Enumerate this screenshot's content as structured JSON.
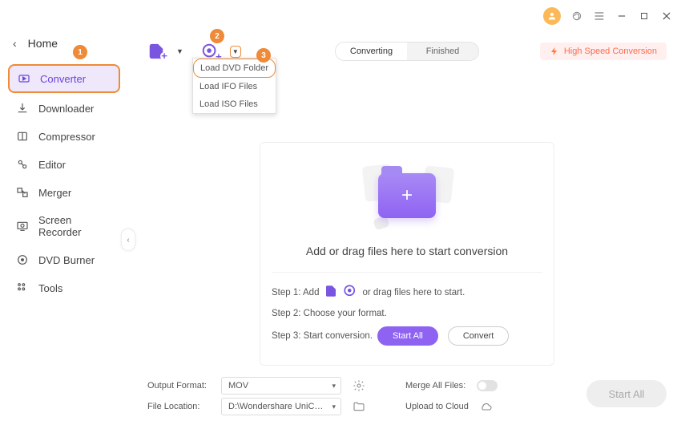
{
  "home_label": "Home",
  "sidebar": {
    "items": [
      {
        "label": "Converter"
      },
      {
        "label": "Downloader"
      },
      {
        "label": "Compressor"
      },
      {
        "label": "Editor"
      },
      {
        "label": "Merger"
      },
      {
        "label": "Screen Recorder"
      },
      {
        "label": "DVD Burner"
      },
      {
        "label": "Tools"
      }
    ]
  },
  "tabs": {
    "converting": "Converting",
    "finished": "Finished"
  },
  "highspeed_label": "High Speed Conversion",
  "load_menu": {
    "items": [
      {
        "label": "Load DVD Folder"
      },
      {
        "label": "Load IFO Files"
      },
      {
        "label": "Load ISO Files"
      }
    ]
  },
  "dropzone": {
    "headline": "Add or drag files here to start conversion",
    "step1_pre": "Step 1: Add",
    "step1_post": "or drag files here to start.",
    "step2": "Step 2: Choose your format.",
    "step3": "Step 3: Start conversion.",
    "startall_btn": "Start All",
    "convert_btn": "Convert"
  },
  "footer": {
    "output_format_label": "Output Format:",
    "output_format_value": "MOV",
    "file_location_label": "File Location:",
    "file_location_value": "D:\\Wondershare UniConverter 1",
    "merge_label": "Merge All Files:",
    "upload_label": "Upload to Cloud"
  },
  "startall_big": "Start All",
  "callouts": {
    "c1": "1",
    "c2": "2",
    "c3": "3"
  }
}
